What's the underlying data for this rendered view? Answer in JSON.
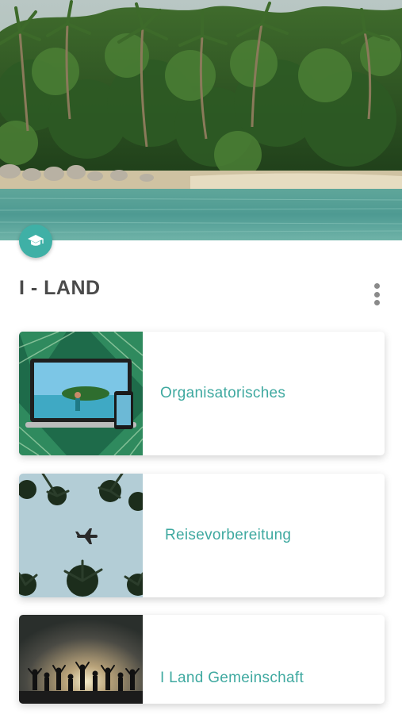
{
  "header": {
    "image": "tropical-island-beach",
    "badge_icon": "graduation-cap-icon",
    "accent_color": "#3fb0a6"
  },
  "page": {
    "title": "I - LAND",
    "menu_icon": "more-vertical-icon"
  },
  "modules": [
    {
      "label": "Organisatorisches",
      "image": "laptop-phone-island-on-leaves"
    },
    {
      "label": "Reisevorbereitung",
      "image": "palm-trees-airplane-sky"
    },
    {
      "label": "I Land Gemeinschaft",
      "image": "group-silhouette-sunset"
    }
  ]
}
